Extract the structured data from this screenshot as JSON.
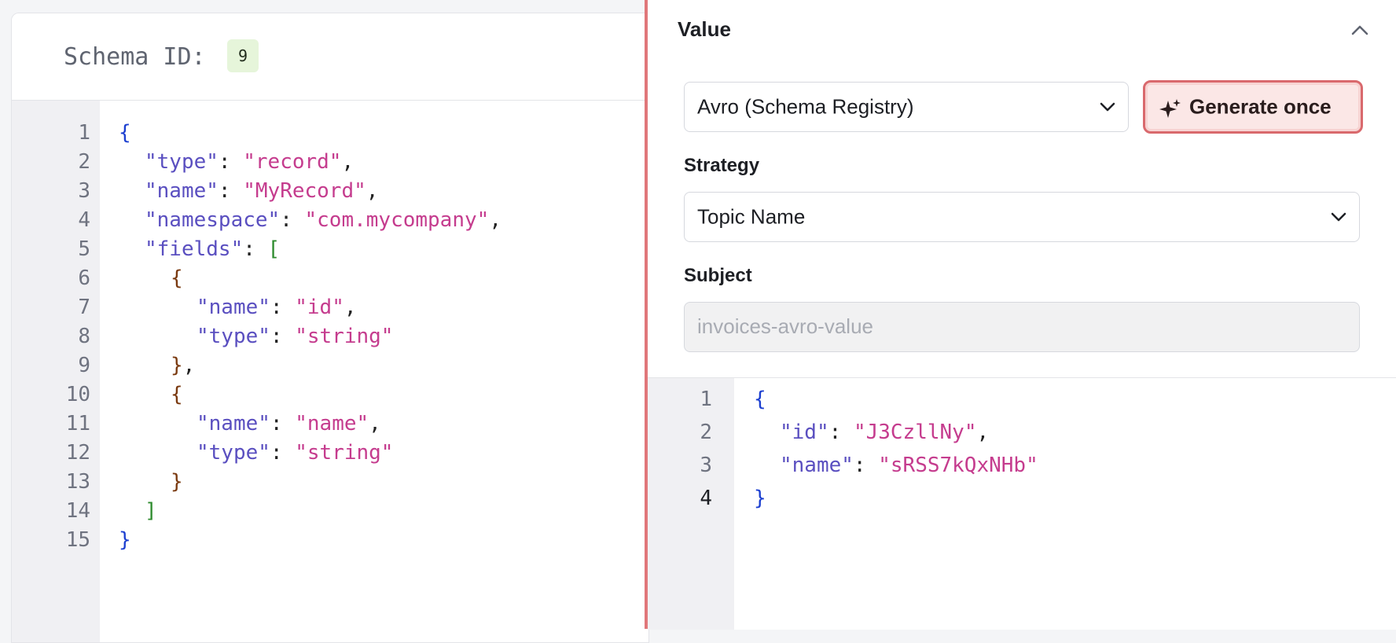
{
  "left": {
    "schema_id_label": "Schema ID:",
    "schema_id": "9",
    "code_lines": [
      {
        "n": "1"
      },
      {
        "n": "2"
      },
      {
        "n": "3"
      },
      {
        "n": "4"
      },
      {
        "n": "5"
      },
      {
        "n": "6"
      },
      {
        "n": "7"
      },
      {
        "n": "8"
      },
      {
        "n": "9"
      },
      {
        "n": "10"
      },
      {
        "n": "11"
      },
      {
        "n": "12"
      },
      {
        "n": "13"
      },
      {
        "n": "14"
      },
      {
        "n": "15"
      }
    ],
    "code": {
      "l1": "{",
      "l2_key": "\"type\"",
      "l2_val": "\"record\"",
      "l3_key": "\"name\"",
      "l3_val": "\"MyRecord\"",
      "l4_key": "\"namespace\"",
      "l4_val": "\"com.mycompany\"",
      "l5_key": "\"fields\"",
      "l5_bracket": "[",
      "l6": "{",
      "l7_key": "\"name\"",
      "l7_val": "\"id\"",
      "l8_key": "\"type\"",
      "l8_val": "\"string\"",
      "l9": "}",
      "l10": "{",
      "l11_key": "\"name\"",
      "l11_val": "\"name\"",
      "l12_key": "\"type\"",
      "l12_val": "\"string\"",
      "l13": "}",
      "l14": "]",
      "l15": "}"
    }
  },
  "right": {
    "section_title": "Value",
    "format_select": "Avro (Schema Registry)",
    "generate_button": "Generate once",
    "strategy_label": "Strategy",
    "strategy_select": "Topic Name",
    "subject_label": "Subject",
    "subject_placeholder": "invoices-avro-value",
    "output": {
      "lines": [
        "1",
        "2",
        "3",
        "4"
      ],
      "open": "{",
      "id_key": "\"id\"",
      "id_val": "\"J3CzllNy\"",
      "name_key": "\"name\"",
      "name_val": "\"sRSS7kQxNHb\"",
      "close": "}"
    }
  },
  "colors": {
    "accent": "#e0777a",
    "key": "#5a4fc0",
    "string": "#c53c8e"
  }
}
